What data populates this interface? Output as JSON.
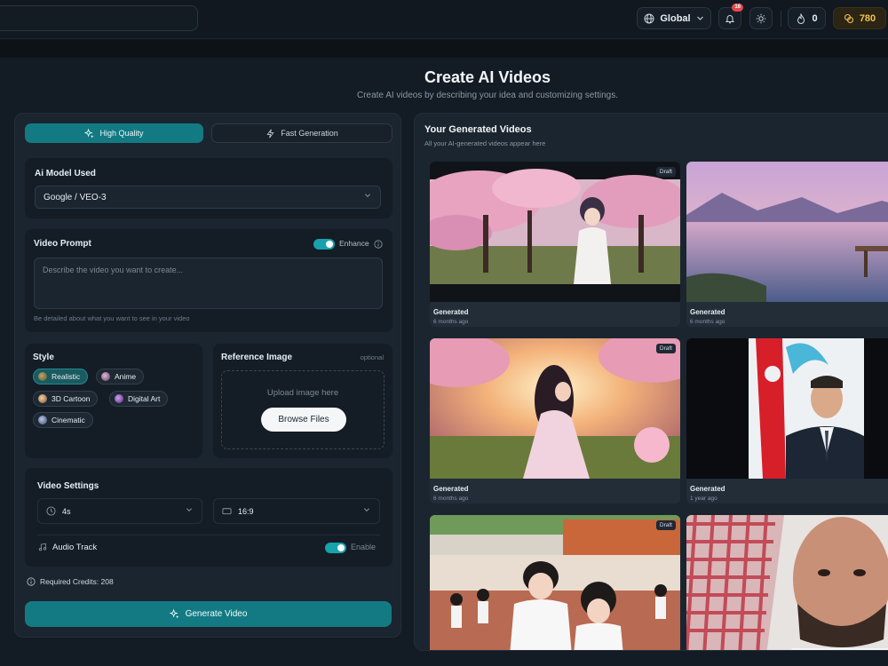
{
  "topbar": {
    "region_label": "Global",
    "notification_count": "16",
    "streak_count": "0",
    "credits": "780"
  },
  "page": {
    "title": "Create AI Videos",
    "subtitle": "Create AI videos by describing your idea and customizing settings."
  },
  "modes": {
    "high_quality": "High Quality",
    "fast_generation": "Fast Generation"
  },
  "model": {
    "label": "Ai Model Used",
    "value": "Google / VEO-3"
  },
  "prompt": {
    "label": "Video Prompt",
    "enhance_label": "Enhance",
    "enhance_on": true,
    "placeholder": "Describe the video you want to create...",
    "hint": "Be detailed about what you want to see in your video"
  },
  "style": {
    "label": "Style",
    "options": [
      {
        "label": "Realistic",
        "selected": true
      },
      {
        "label": "Anime",
        "selected": false
      },
      {
        "label": "3D Cartoon",
        "selected": false
      },
      {
        "label": "Digital Art",
        "selected": false
      },
      {
        "label": "Cinematic",
        "selected": false
      }
    ]
  },
  "reference": {
    "label": "Reference Image",
    "optional": "optional",
    "upload_text": "Upload image here",
    "browse_label": "Browse Files"
  },
  "settings": {
    "label": "Video Settings",
    "duration": "4s",
    "aspect": "16:9",
    "audio_label": "Audio Track",
    "audio_toggle_label": "Enable",
    "audio_on": true
  },
  "required_credits": "Required Credits: 208",
  "generate_label": "Generate Video",
  "gallery": {
    "title": "Your Generated Videos",
    "subtitle": "All your AI-generated videos appear here",
    "videos": [
      {
        "status": "Generated",
        "time": "6 months ago",
        "badge": "Draft",
        "scene": "anime-cherry-blossom-boy"
      },
      {
        "status": "Generated",
        "time": "6 months ago",
        "badge": "",
        "scene": "lake-sunrise-mountains"
      },
      {
        "status": "Generated",
        "time": "6 months ago",
        "badge": "Draft",
        "scene": "anime-girl-sunset-field"
      },
      {
        "status": "Generated",
        "time": "1 year ago",
        "badge": "",
        "scene": "man-with-flags"
      },
      {
        "status": "",
        "time": "",
        "badge": "Draft",
        "scene": "anime-school-students"
      },
      {
        "status": "",
        "time": "",
        "badge": "",
        "scene": "man-in-keffiyeh"
      }
    ]
  },
  "colors": {
    "accent": "#137a83",
    "toggle": "#17a2ad",
    "credits_gold": "#f2c14e",
    "notification": "#e5484d"
  }
}
